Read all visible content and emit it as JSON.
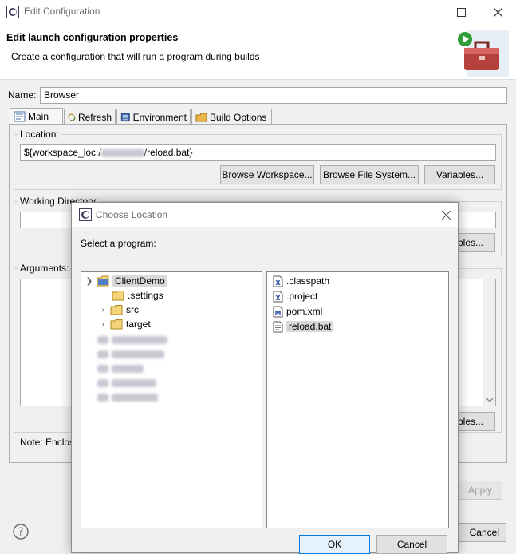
{
  "window": {
    "title": "Edit Configuration"
  },
  "banner": {
    "title": "Edit launch configuration properties",
    "subtitle": "Create a configuration that will run a program during builds"
  },
  "name_field": {
    "label": "Name:",
    "value": "Browser"
  },
  "tabs": [
    {
      "label": "Main",
      "icon": "main-tab-icon"
    },
    {
      "label": "Refresh",
      "icon": "refresh-icon"
    },
    {
      "label": "Environment",
      "icon": "environment-icon"
    },
    {
      "label": "Build Options",
      "icon": "build-options-icon"
    }
  ],
  "main_tab": {
    "location": {
      "label": "Location:",
      "value_prefix": "${workspace_loc:/",
      "value_suffix": "/reload.bat}",
      "buttons": {
        "browse_workspace": "Browse Workspace...",
        "browse_file_system": "Browse File System...",
        "variables": "Variables..."
      }
    },
    "working_directory": {
      "label": "Working Directory:",
      "variables_partial": "bles..."
    },
    "arguments": {
      "label": "Arguments:",
      "variables_partial": "bles..."
    },
    "note": "Note: Enclos"
  },
  "footer": {
    "apply_partial": "Apply",
    "cancel_partial": "Cancel",
    "help_icon": "help-icon"
  },
  "dialog": {
    "title": "Choose Location",
    "prompt": "Select a program:",
    "tree": [
      {
        "label": "ClientDemo",
        "expanded": true,
        "selected": true,
        "level": 0
      },
      {
        "label": ".settings",
        "level": 1
      },
      {
        "label": "src",
        "level": 1,
        "collapsed": true
      },
      {
        "label": "target",
        "level": 1,
        "collapsed": true
      }
    ],
    "files": [
      {
        "label": ".classpath",
        "icon": "xml-file-icon"
      },
      {
        "label": ".project",
        "icon": "xml-file-icon"
      },
      {
        "label": "pom.xml",
        "icon": "maven-file-icon"
      },
      {
        "label": "reload.bat",
        "icon": "bat-file-icon",
        "selected": true
      }
    ],
    "ok": "OK",
    "cancel": "Cancel"
  }
}
